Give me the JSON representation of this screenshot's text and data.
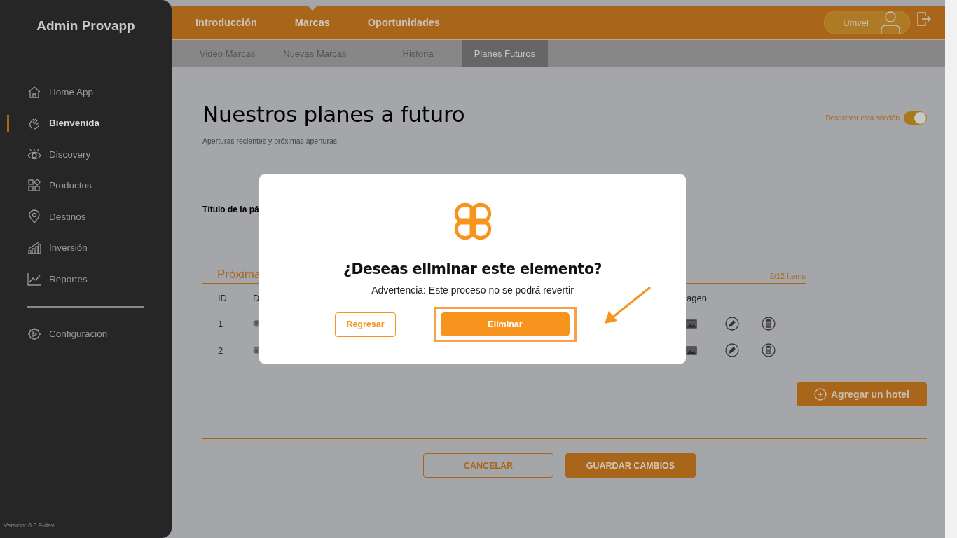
{
  "sidebar": {
    "title": "Admin Provapp",
    "items": [
      {
        "label": "Home App",
        "selected": false
      },
      {
        "label": "Bienvenida",
        "selected": true
      },
      {
        "label": "Discovery",
        "selected": false
      },
      {
        "label": "Productos",
        "selected": false
      },
      {
        "label": "Destinos",
        "selected": false
      },
      {
        "label": "Inversión",
        "selected": false
      },
      {
        "label": "Reportes",
        "selected": false
      }
    ],
    "footer_items": [
      {
        "label": "Configuración",
        "selected": false
      }
    ],
    "version": "Versión: 0.0.9-dev"
  },
  "tabs": [
    {
      "label": "Introducción",
      "selected": false
    },
    {
      "label": "Marcas",
      "selected": true
    },
    {
      "label": "Oportunidades",
      "selected": false
    }
  ],
  "user": {
    "name": "Umvel"
  },
  "subtabs": [
    {
      "label": "Video Marcas",
      "selected": false
    },
    {
      "label": "Nuevas Marcas",
      "selected": false
    },
    {
      "label": "Historia",
      "selected": false
    },
    {
      "label": "Planes Futuros",
      "selected": true
    }
  ],
  "page": {
    "title": "Nuestros planes a futuro",
    "subtitle": "Aperturas recientes y próximas aperturas.",
    "toggle": {
      "label": "Desactivar esta sección",
      "on": true
    },
    "field_label": "Título de la pá",
    "section": {
      "title": "Próxima",
      "count": "2/12 ítems",
      "columns": [
        "ID",
        "D",
        "agen"
      ],
      "rows": [
        {
          "id": "1"
        },
        {
          "id": "2"
        }
      ]
    },
    "add_button": "Agregar un hotel",
    "cancel_button": "CANCELAR",
    "save_button": "GUARDAR CAMBIOS"
  },
  "dialog": {
    "title": "¿Deseas eliminar este elemento?",
    "message": "Advertencia: Este proceso no se podrá revertir",
    "back_button": "Regresar",
    "delete_button": "Eliminar"
  }
}
